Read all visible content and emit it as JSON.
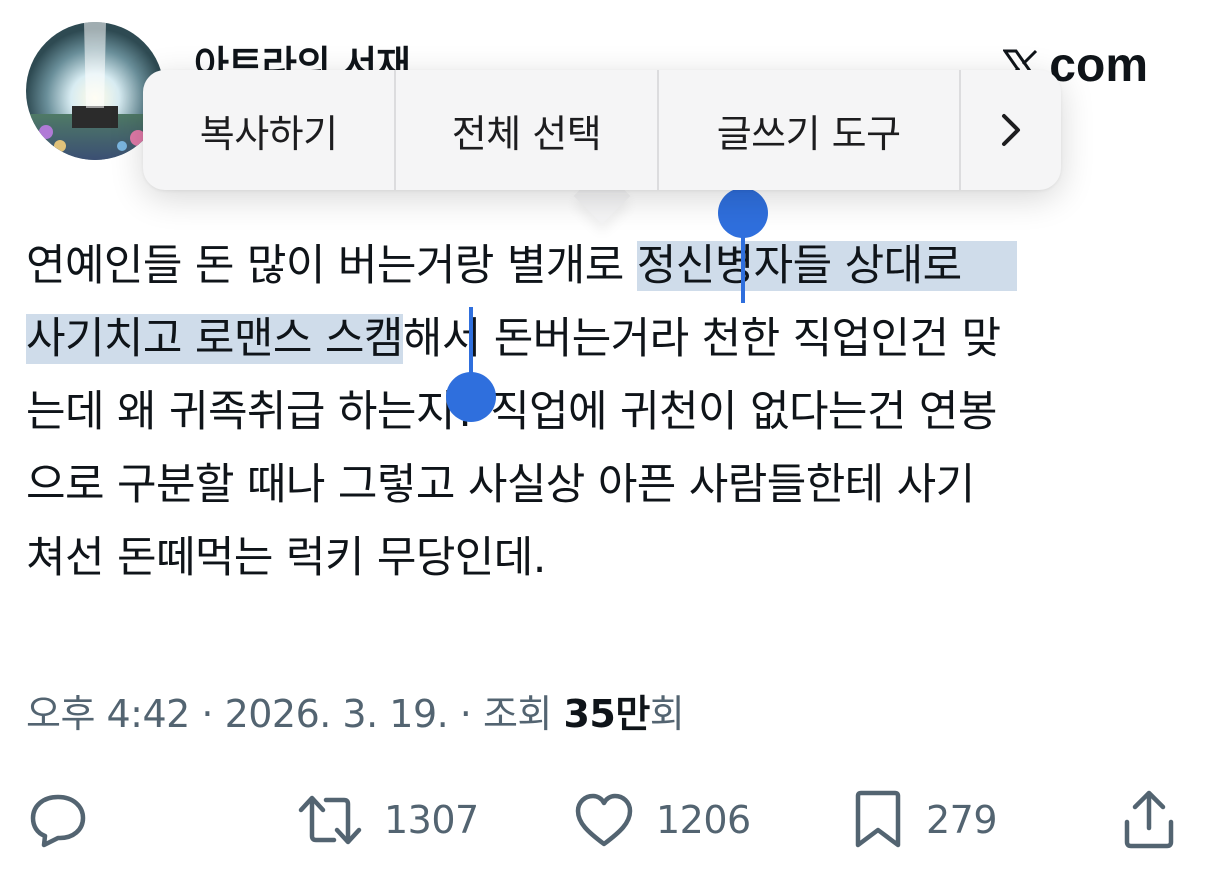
{
  "header": {
    "author_name": "아트라의 서재",
    "brand_text": "com"
  },
  "context_menu": {
    "items": [
      "복사하기",
      "전체 선택",
      "글쓰기 도구"
    ],
    "more_label": "›"
  },
  "tweet": {
    "lines": [
      {
        "before": "연예인들 돈 많이 버는거랑 별개로 ",
        "selected": "정신병자들 상대로",
        "after": ""
      },
      {
        "before": "",
        "selected": "사기치고 로맨스 스캠",
        "after": "해서 돈버는거라 천한 직업인건 맞"
      },
      {
        "before": "는데 왜 귀족취급 하는지? 직업에 귀천이 없다는건 연봉",
        "selected": "",
        "after": ""
      },
      {
        "before": "으로 구분할 때나 그렇고 사실상 아픈 사람들한테 사기",
        "selected": "",
        "after": ""
      },
      {
        "before": "쳐선 돈떼먹는 럭키 무당인데.",
        "selected": "",
        "after": ""
      }
    ],
    "timestamp": "오후 4:42 · 2026. 3. 19. · 조회 ",
    "views_count": "35만",
    "views_suffix": "회"
  },
  "actions": {
    "retweets": "1307",
    "likes": "1206",
    "bookmarks": "279"
  },
  "colors": {
    "selection": "#cfdcea",
    "handle": "#2f6fdd",
    "secondary_text": "#536471",
    "text": "#0f1419"
  },
  "icons": [
    "reply-icon",
    "retweet-icon",
    "like-icon",
    "bookmark-icon",
    "share-icon",
    "x-logo-icon",
    "chevron-right-icon"
  ]
}
